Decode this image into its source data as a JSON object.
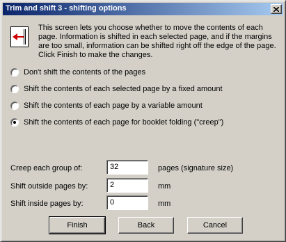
{
  "window": {
    "title": "Trim and shift 3 - shifting options"
  },
  "intro_text": "This screen lets you choose whether to move the contents of each page. Information is shifted in each selected page, and if the margins are too small, information can be shifted right off the edge of the page. Click Finish to make the changes.",
  "options": [
    {
      "label": "Don't shift the contents of the pages",
      "checked": false
    },
    {
      "label": "Shift the contents of each selected page by a fixed amount",
      "checked": false
    },
    {
      "label": "Shift the contents of each page by a variable amount",
      "checked": false
    },
    {
      "label": "Shift the contents of each page for booklet folding (\"creep\")",
      "checked": true
    }
  ],
  "fields": [
    {
      "label": "Creep each group of:",
      "value": "32",
      "unit": "pages (signature size)"
    },
    {
      "label": "Shift outside pages by:",
      "value": "2",
      "unit": "mm"
    },
    {
      "label": "Shift inside pages by:",
      "value": "0",
      "unit": "mm"
    }
  ],
  "buttons": {
    "finish": "Finish",
    "back": "Back",
    "cancel": "Cancel"
  },
  "icons": {
    "close": "close-icon",
    "info": "shift-arrow-icon"
  },
  "colors": {
    "titlebar_start": "#0a246a",
    "titlebar_end": "#a6caf0",
    "face": "#d4d0c8",
    "arrow": "#cc0000"
  }
}
